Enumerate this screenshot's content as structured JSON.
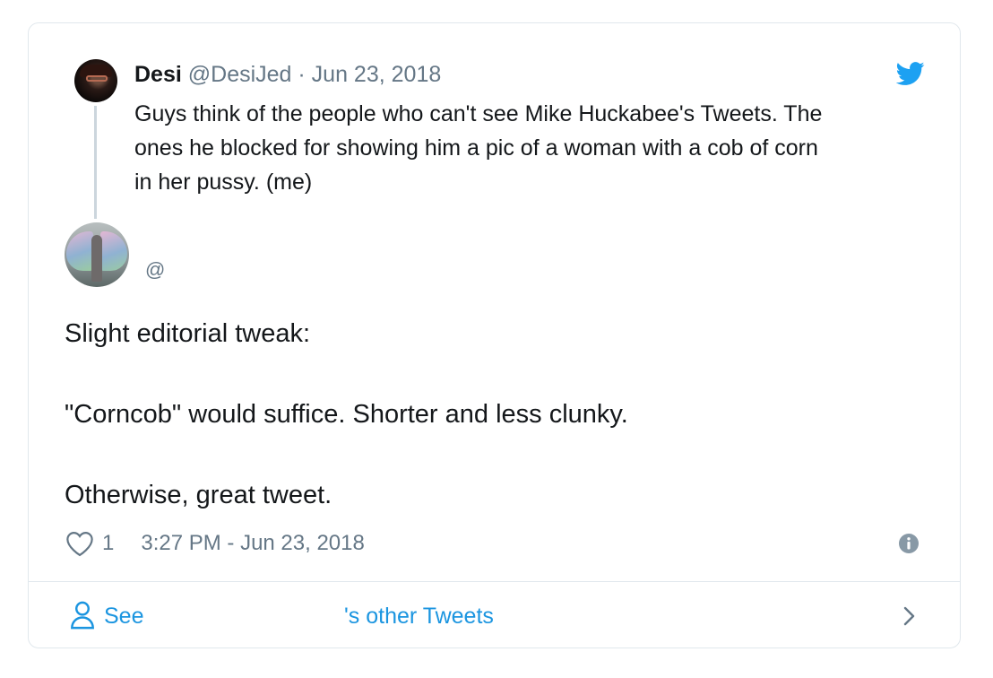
{
  "quoted_tweet": {
    "name": "Desi",
    "handle_and_date": "@DesiJed · Jun 23, 2018",
    "text": "Guys think of the people who can't see Mike Huckabee's Tweets. The\nones he blocked for showing him a pic of a woman with a cob of corn\nin her pussy. (me)"
  },
  "author": {
    "handle": "@"
  },
  "tweet": {
    "text": "Slight editorial tweak:\n\n\"Corncob\" would suffice. Shorter and less clunky.\n\nOtherwise, great tweet.",
    "like_count": "1",
    "timestamp": "3:27 PM - Jun 23, 2018"
  },
  "footer": {
    "see_label": "See",
    "other_tweets_label": "'s other Tweets"
  },
  "icons": {
    "brand": "twitter-bird-icon",
    "like": "heart-icon",
    "info": "info-icon",
    "profile": "person-icon",
    "next": "chevron-right-icon"
  },
  "colors": {
    "link": "#1b95e0",
    "secondary_text": "#657786",
    "primary_text": "#14171a",
    "border": "#e1e8ed",
    "thread_line": "#ccd6dd"
  }
}
